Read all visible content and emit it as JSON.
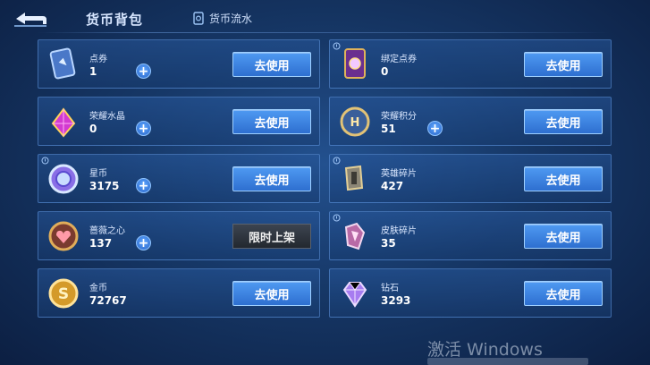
{
  "header": {
    "title": "货币背包",
    "flow_link": "货币流水",
    "back_icon": "back-arrow-icon"
  },
  "items": [
    {
      "name": "点券",
      "value": "1",
      "button": "去使用",
      "has_plus": true,
      "corner_mark": false,
      "icon": "voucher-card-icon"
    },
    {
      "name": "绑定点券",
      "value": "0",
      "button": "去使用",
      "has_plus": false,
      "corner_mark": true,
      "icon": "bound-voucher-card-icon"
    },
    {
      "name": "荣耀水晶",
      "value": "0",
      "button": "去使用",
      "has_plus": true,
      "corner_mark": false,
      "icon": "glory-crystal-icon"
    },
    {
      "name": "荣耀积分",
      "value": "51",
      "button": "去使用",
      "has_plus": true,
      "corner_mark": false,
      "icon": "glory-points-coin-icon"
    },
    {
      "name": "星币",
      "value": "3175",
      "button": "去使用",
      "has_plus": true,
      "corner_mark": true,
      "icon": "star-coin-icon"
    },
    {
      "name": "英雄碎片",
      "value": "427",
      "button": "去使用",
      "has_plus": false,
      "corner_mark": true,
      "icon": "hero-fragment-icon"
    },
    {
      "name": "蔷薇之心",
      "value": "137",
      "button": "限时上架",
      "has_plus": true,
      "corner_mark": false,
      "icon": "rose-heart-coin-icon"
    },
    {
      "name": "皮肤碎片",
      "value": "35",
      "button": "去使用",
      "has_plus": false,
      "corner_mark": true,
      "icon": "skin-fragment-icon"
    },
    {
      "name": "金币",
      "value": "72767",
      "button": "去使用",
      "has_plus": false,
      "corner_mark": false,
      "icon": "gold-coin-icon"
    },
    {
      "name": "钻石",
      "value": "3293",
      "button": "去使用",
      "has_plus": false,
      "corner_mark": false,
      "icon": "diamond-icon"
    }
  ],
  "watermark": "激活 Windows",
  "colors": {
    "accent_button": "#3f86e4",
    "card_border": "#6096dc",
    "background": "#163766"
  }
}
